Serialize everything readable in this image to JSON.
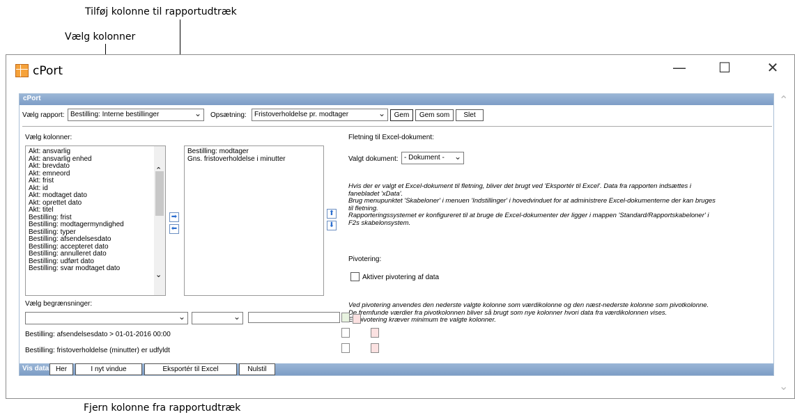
{
  "callouts": {
    "add_column": "Tilføj kolonne til rapportudtræk",
    "choose_columns": "Vælg kolonner",
    "remove_column": "Fjern kolonne fra rapportudtræk"
  },
  "window": {
    "title": "cPort",
    "minimize": "—",
    "maximize": "☐",
    "close": "✕"
  },
  "panel": {
    "header": "cPort",
    "report_label": "Vælg rapport:",
    "report_value": "Bestilling: Interne bestillinger",
    "setup_label": "Opsætning:",
    "setup_value": "Fristoverholdelse pr. modtager",
    "save": "Gem",
    "save_as": "Gem som",
    "delete": "Slet",
    "columns_label": "Vælg kolonner:",
    "available_columns": [
      "Akt: ansvarlig",
      "Akt: ansvarlig enhed",
      "Akt: brevdato",
      "Akt: emneord",
      "Akt: frist",
      "Akt: id",
      "Akt: modtaget dato",
      "Akt: oprettet dato",
      "Akt: titel",
      "Bestilling: frist",
      "Bestilling: modtagermyndighed",
      "Bestilling: typer",
      "Bestilling: afsendelsesdato",
      "Bestilling: accepteret dato",
      "Bestilling: annulleret dato",
      "Bestilling: udført dato",
      "Bestilling: svar modtaget dato"
    ],
    "selected_columns": [
      "Bestilling: modtager",
      "Gns. fristoverholdelse i minutter"
    ],
    "merge_label": "Fletning til Excel-dokument:",
    "doc_label": "Valgt dokument:",
    "doc_value": "- Dokument -",
    "info_text": [
      "Hvis der er valgt et Excel-dokument til fletning, bliver det brugt ved 'Eksportér til Excel'. Data fra rapporten indsættes i",
      "fanebladet 'xData'.",
      "Brug menupunktet 'Skabeloner' i menuen 'Indstillinger' i hovedvinduet for at administrere Excel-dokumenterne der kan bruges",
      "til fletning.",
      "Rapporteringssystemet er konfigureret til at bruge de Excel-dokumenter der ligger i mappen 'Standard/Rapportskabeloner' i",
      "F2s skabelonsystem."
    ],
    "pivot_label": "Pivotering:",
    "pivot_checkbox": "Aktiver pivotering af data",
    "pivot_info": [
      "Ved pivotering anvendes den nederste valgte kolonne som værdikolonne og den næst-nederste kolonne som pivotkolonne.",
      "De fremfunde værdier fra pivotkolonnen bliver så brugt som nye kolonner hvori data fra værdikolonnen vises.",
      "En pivotering kræver minimum tre valgte kolonner."
    ],
    "limits_label": "Vælg begrænsninger:",
    "limits": [
      "Bestilling: afsendelsesdato > 01-01-2016 00:00",
      "Bestilling: fristoverholdelse (minutter) er udfyldt"
    ],
    "show_data_label": "Vis data:",
    "btn_here": "Her",
    "btn_new_window": "I nyt vindue",
    "btn_export": "Eksportér til Excel",
    "btn_reset": "Nulstil"
  },
  "icons": {
    "add": "arrow-right-icon",
    "remove": "arrow-left-icon",
    "up": "arrow-up-icon",
    "down": "arrow-down-icon"
  }
}
